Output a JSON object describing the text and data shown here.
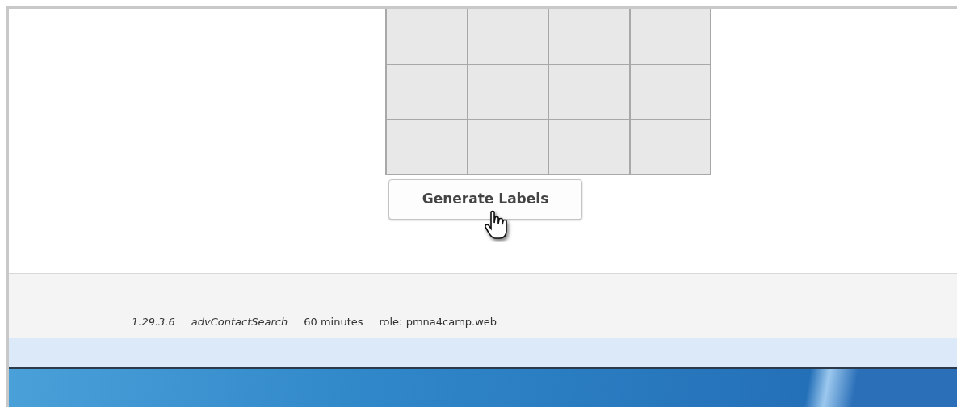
{
  "button": {
    "label": "Generate Labels"
  },
  "footer": {
    "items": [
      {
        "text": "1.29.3.6",
        "kind": "italic"
      },
      {
        "text": "advContactSearch",
        "kind": "italic"
      },
      {
        "text": "60 minutes",
        "kind": "plain"
      },
      {
        "text": "role: pmna4camp.web",
        "kind": "plain"
      }
    ]
  }
}
